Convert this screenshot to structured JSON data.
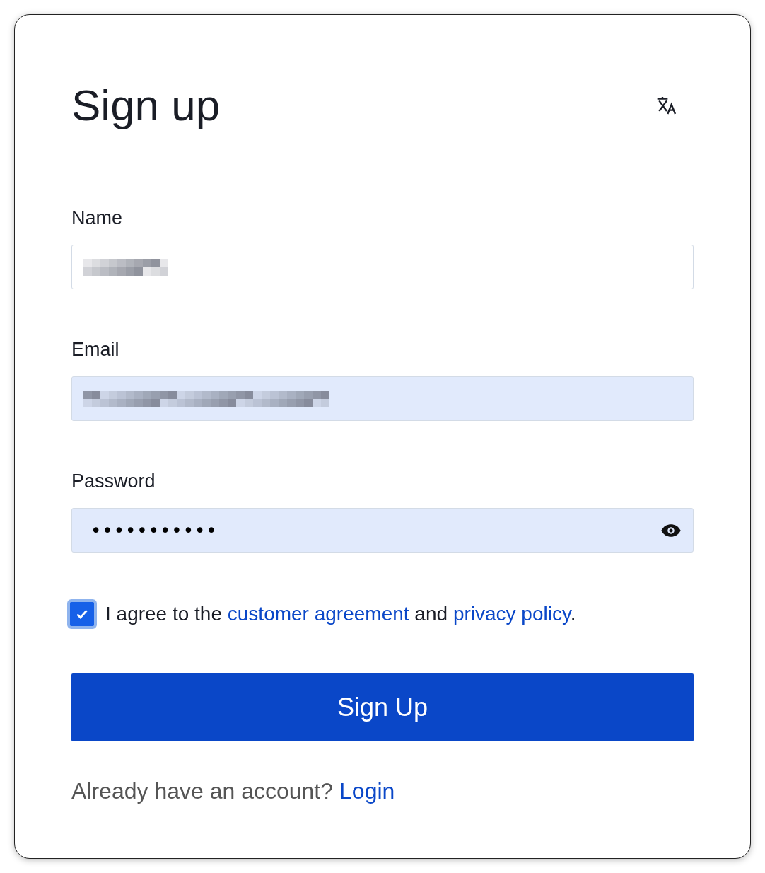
{
  "title": "Sign up",
  "fields": [
    {
      "label": "Name",
      "kind": "redacted",
      "autofilled": false
    },
    {
      "label": "Email",
      "kind": "redacted",
      "autofilled": true
    },
    {
      "label": "Password",
      "kind": "password",
      "value": "•••••••••••",
      "autofilled": true
    }
  ],
  "agreement": {
    "checked": true,
    "parts": [
      {
        "kind": "text",
        "text": "I agree to the "
      },
      {
        "kind": "link",
        "text": "customer agreement"
      },
      {
        "kind": "text",
        "text": " and "
      },
      {
        "kind": "link",
        "text": "privacy policy"
      },
      {
        "kind": "text",
        "text": "."
      }
    ]
  },
  "submit": "Sign Up",
  "footer": {
    "text": "Already have an account?",
    "link": "Login"
  }
}
